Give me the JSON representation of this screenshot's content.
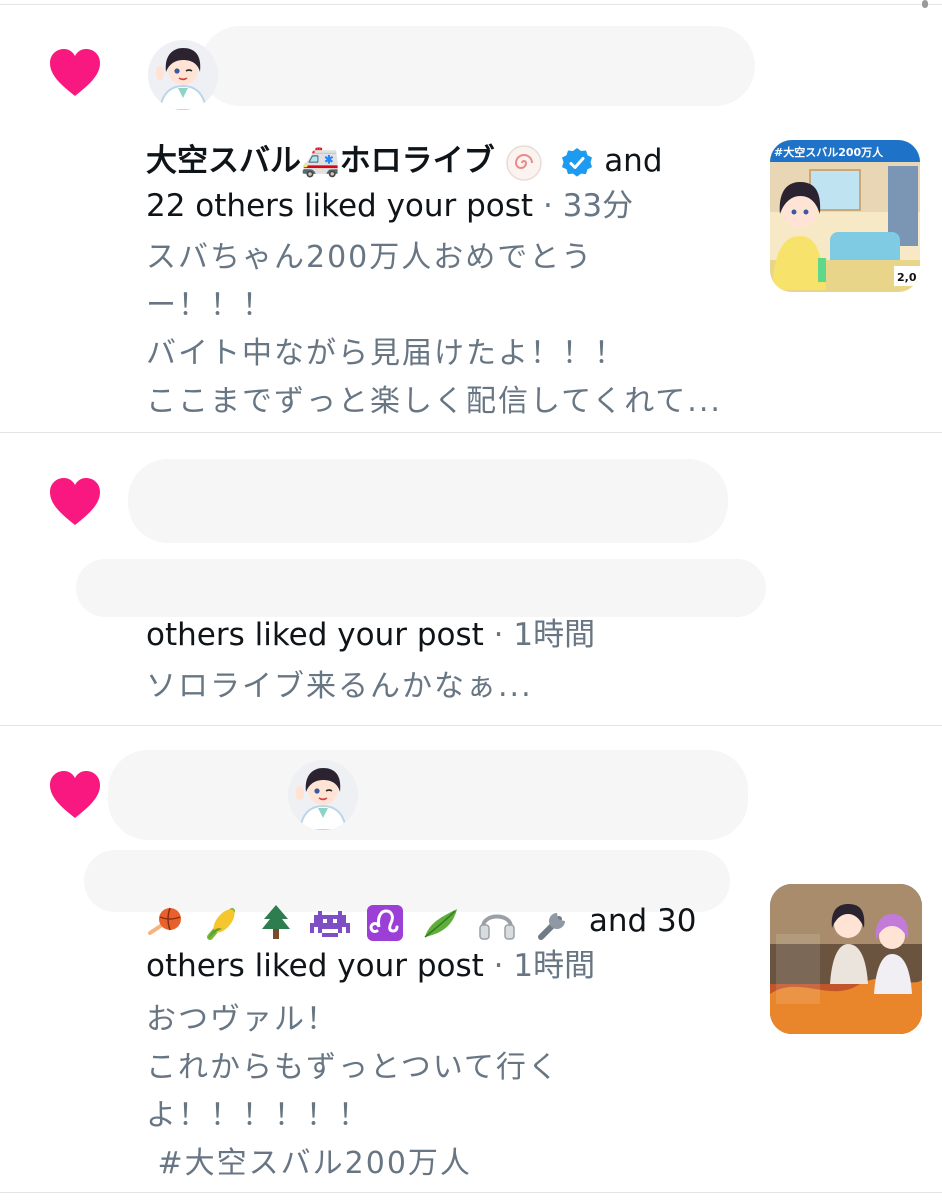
{
  "notifications": [
    {
      "author": "大空スバル🚑ホロライブ",
      "and_text": "and",
      "liked_text": "22 others liked your post",
      "separator": "·",
      "time": "33分",
      "body_lines": [
        "スバちゃん200万人おめでとう",
        "ー！！！",
        "バイト中ながら見届けたよ！！！",
        "ここまでずっと楽しく配信してくれて..."
      ],
      "thumb_label": "#大空スバル200万人",
      "thumb_corner": "2,0"
    },
    {
      "liked_text": "others liked your post",
      "separator": "·",
      "time": "1時間",
      "body_lines": [
        "ソロライブ来るんかなぁ..."
      ]
    },
    {
      "liked_prefix_emojis": [
        "basketball-icon",
        "corn-icon",
        "tree-icon",
        "alien-monster-icon",
        "leo-icon",
        "leaves-icon",
        "headphones-icon",
        "wrench-icon"
      ],
      "and_text": "and 30",
      "liked_text": "others liked your post",
      "separator": "·",
      "time": "1時間",
      "body_lines": [
        "おつヴァル！",
        "これからもずっとついて行く",
        "よ！！！！！！",
        " #大空スバル200万人"
      ]
    }
  ],
  "colors": {
    "heart": "#f91880",
    "secondary_text": "#687684",
    "primary_text": "#0f1419",
    "verified": "#1d9bf0"
  }
}
